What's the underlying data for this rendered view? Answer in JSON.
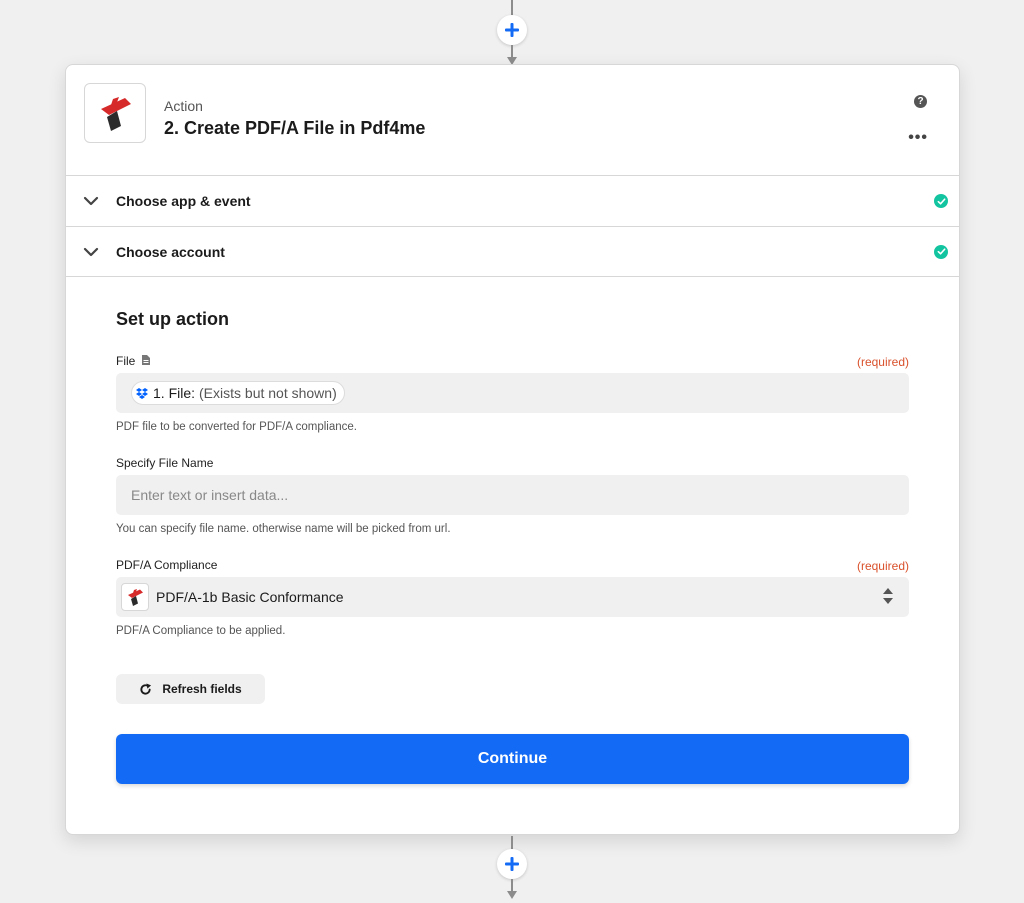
{
  "step": {
    "type_label": "Action",
    "title": "2. Create PDF/A File in Pdf4me",
    "help_icon": "help-icon",
    "more_icon": "more-options-icon",
    "help_glyph": "?",
    "more_glyph": "•••"
  },
  "sections": {
    "app_event": {
      "label": "Choose app & event",
      "status": "complete"
    },
    "account": {
      "label": "Choose account",
      "status": "complete"
    }
  },
  "setup": {
    "title": "Set up action",
    "file": {
      "label": "File",
      "required": "(required)",
      "pill_label": "1. File:",
      "pill_value": "(Exists but not shown)",
      "help": "PDF file to be converted for PDF/A compliance."
    },
    "file_name": {
      "label": "Specify File Name",
      "placeholder": "Enter text or insert data...",
      "help": "You can specify file name. otherwise name will be picked from url."
    },
    "compliance": {
      "label": "PDF/A Compliance",
      "required": "(required)",
      "value": "PDF/A-1b Basic Conformance",
      "help": "PDF/A Compliance to be applied."
    },
    "refresh_label": "Refresh fields",
    "continue_label": "Continue"
  },
  "colors": {
    "accent": "#136bf5",
    "success": "#13c4a0",
    "required": "#d9512c",
    "brand_red": "#d62a2a"
  }
}
